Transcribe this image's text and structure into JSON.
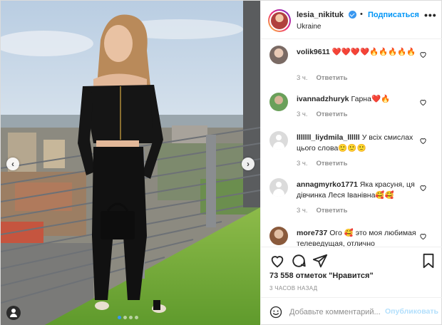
{
  "post": {
    "username": "lesia_nikituk",
    "separator": "•",
    "follow_label": "Подписаться",
    "location": "Ukraine",
    "more_label": "•••",
    "carousel_dots": 4,
    "active_dot": 0
  },
  "comments": [
    {
      "user": "volik9611",
      "text": "❤️❤️❤️❤️🔥🔥🔥🔥🔥",
      "time": "3 ч.",
      "reply": "Ответить",
      "avatar": "photo"
    },
    {
      "user": "ivannadzhuryk",
      "text": "Гарна❤️🔥",
      "time": "3 ч.",
      "reply": "Ответить",
      "avatar": "photo"
    },
    {
      "user": "lllllll_liydmila_llllll",
      "text": "У всіх смислах цього слова🙂🙂🙂",
      "time": "3 ч.",
      "reply": "Ответить",
      "avatar": "default"
    },
    {
      "user": "annagmyrko1771",
      "text": "Яка красуня, ця дівчинка Леся Іванівна🥰🥰",
      "time": "3 ч.",
      "reply": "Ответить",
      "avatar": "default"
    },
    {
      "user": "more737",
      "text": "Ого 🥰 это моя любимая телеведущая, отлично",
      "time": "",
      "reply": "",
      "avatar": "photo"
    }
  ],
  "footer": {
    "likes": "73 558 отметок \"Нравится\"",
    "time_ago": "3 ЧАСОВ НАЗАД",
    "comment_placeholder": "Добавьте комментарий...",
    "publish_label": "Опубликовать"
  },
  "colors": {
    "accent": "#0095f6",
    "publish_disabled": "#b2dffc",
    "heart_red": "#ed4956",
    "muted": "#8e8e8e"
  }
}
